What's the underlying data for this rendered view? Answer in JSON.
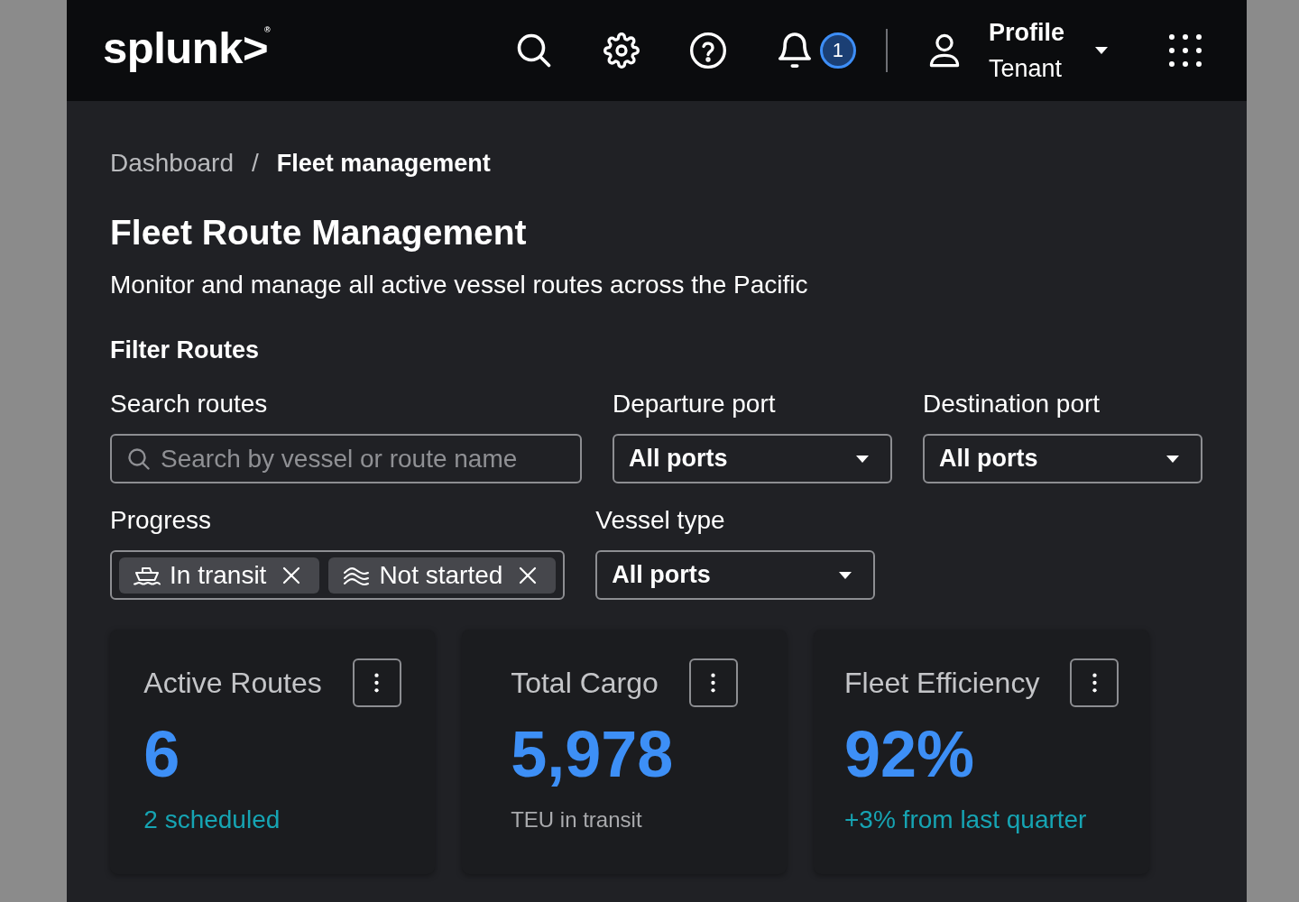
{
  "header": {
    "logo": "splunk>$^{®}$",
    "notification_count": "1",
    "profile": {
      "name": "Profile",
      "tenant": "Tenant"
    }
  },
  "breadcrumb": {
    "separator": "/",
    "items": [
      {
        "label": "Dashboard",
        "current": false
      },
      {
        "label": "Fleet management",
        "current": true
      }
    ]
  },
  "page": {
    "title": "Fleet Route Management",
    "subtitle": "Monitor and manage all active vessel routes across the Pacific"
  },
  "filters": {
    "title": "Filter Routes",
    "rows": [
      [
        {
          "kind": "search",
          "label": "Search routes",
          "placeholder": "Search by vessel or route name"
        },
        {
          "kind": "select",
          "label": "Departure port",
          "value": "All ports"
        },
        {
          "kind": "select",
          "label": "Destination port",
          "value": "All ports"
        }
      ],
      [
        {
          "kind": "chips",
          "label": "Progress",
          "chips": [
            {
              "label": "In transit"
            },
            {
              "label": "Not started"
            }
          ]
        },
        {
          "kind": "select",
          "label": "Vessel type",
          "value": "All ports"
        }
      ]
    ]
  },
  "summary_cards": [
    {
      "title": "Active Routes",
      "value": "6",
      "note": "2 scheduled",
      "kind": "trend"
    },
    {
      "title": "Total Cargo",
      "value": "5,978",
      "note": "TEU in transit",
      "kind": "caption"
    },
    {
      "title": "Fleet Efficiency",
      "value": "92%",
      "note": "+3% from last quarter",
      "kind": "trend"
    }
  ]
}
